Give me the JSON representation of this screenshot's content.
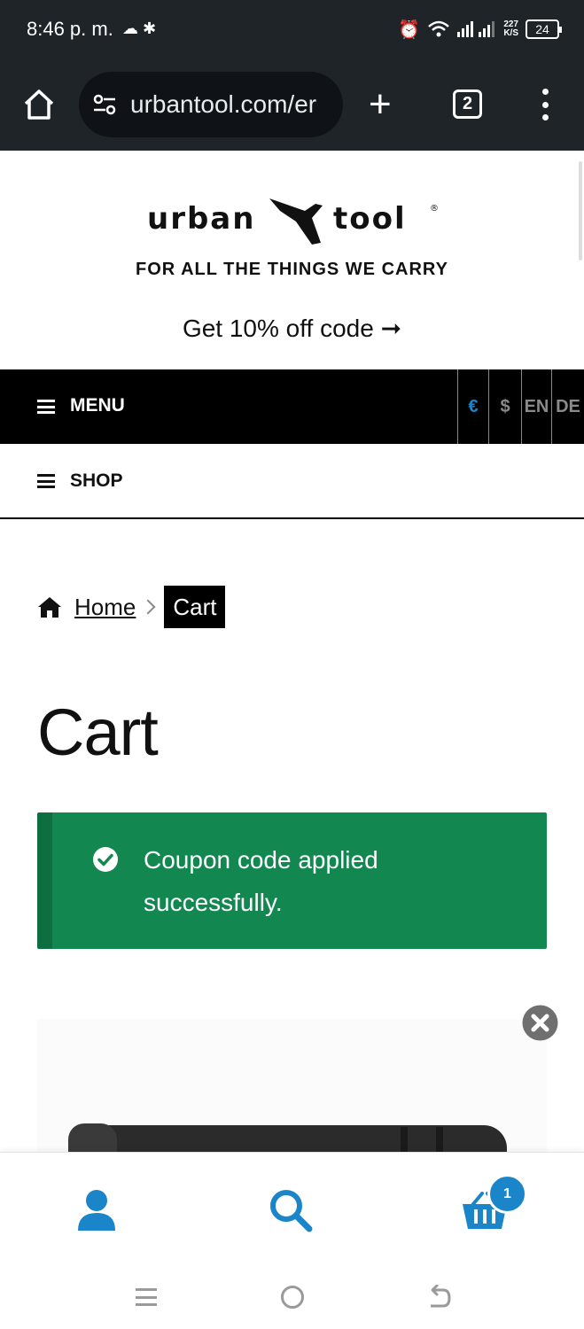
{
  "status_bar": {
    "time": "8:46 p. m.",
    "net_speed_value": "227",
    "net_speed_unit": "K/S",
    "battery": "24"
  },
  "browser": {
    "url": "urbantool.com/er",
    "tab_count": "2",
    "new_tab_symbol": "+"
  },
  "header": {
    "logo_left": "urban",
    "logo_right": "tool",
    "logo_mark": "®",
    "tagline": "FOR ALL THE THINGS WE CARRY",
    "promo": "Get 10% off code ➞"
  },
  "menu_bar": {
    "menu_label": "MENU",
    "options": [
      "€",
      "$",
      "EN",
      "DE"
    ]
  },
  "shop_bar": {
    "label": "SHOP"
  },
  "breadcrumb": {
    "home": "Home",
    "current": "Cart"
  },
  "page": {
    "title": "Cart"
  },
  "notice": {
    "message": "Coupon code applied successfully."
  },
  "cart": {
    "count": "1"
  },
  "colors": {
    "accent": "#1a86c9",
    "success": "#128750",
    "success_border": "#0d6e3f",
    "chrome": "#1f2429"
  },
  "icons": {
    "home": "home-icon",
    "site_settings": "tune-icon",
    "breadcrumb_home": "house-icon",
    "notice": "check-circle-icon",
    "remove": "close-circle-icon",
    "account": "user-icon",
    "search": "search-icon",
    "cart": "basket-icon"
  }
}
